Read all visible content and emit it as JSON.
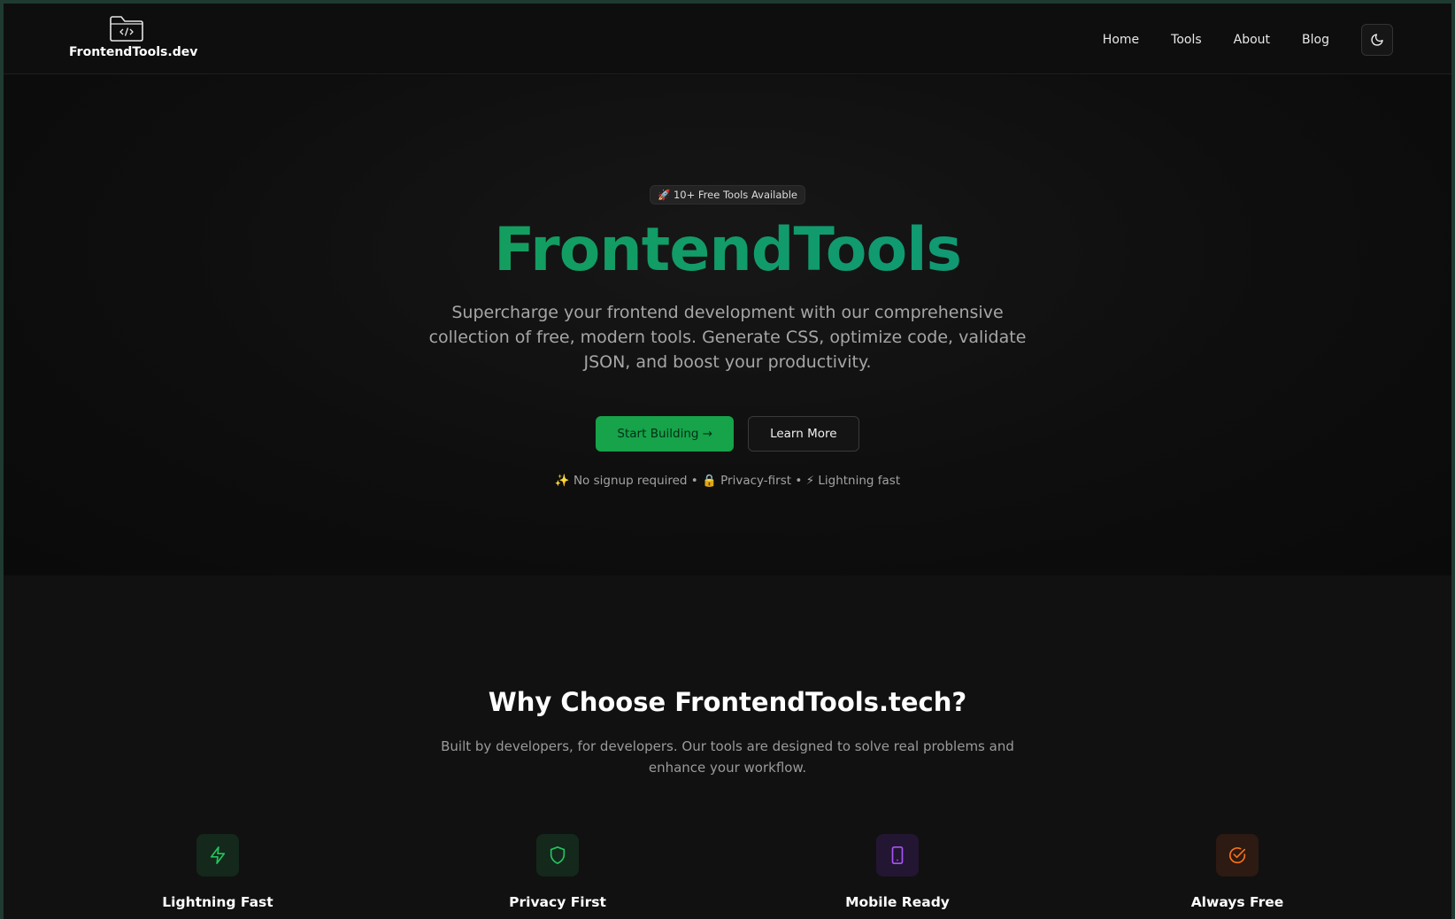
{
  "nav": {
    "logo_text": "FrontendTools.dev",
    "links": [
      "Home",
      "Tools",
      "About",
      "Blog"
    ],
    "theme_toggle_icon": "moon-icon"
  },
  "hero": {
    "badge": "🚀 10+ Free Tools Available",
    "title": "FrontendTools",
    "description": "Supercharge your frontend development with our comprehensive collection of free, modern tools. Generate CSS, optimize code, validate JSON, and boost your productivity.",
    "primary_cta": "Start Building →",
    "secondary_cta": "Learn More",
    "perks": "✨ No signup required • 🔒 Privacy-first • ⚡ Lightning fast"
  },
  "features": {
    "title": "Why Choose FrontendTools.tech?",
    "description": "Built by developers, for developers. Our tools are designed to solve real problems and enhance your workflow.",
    "items": [
      {
        "title": "Lightning Fast",
        "icon": "lightning-icon",
        "color": "#22c55e",
        "bg": "#14281c"
      },
      {
        "title": "Privacy First",
        "icon": "shield-icon",
        "color": "#22c55e",
        "bg": "#14281c"
      },
      {
        "title": "Mobile Ready",
        "icon": "mobile-icon",
        "color": "#a855f7",
        "bg": "#231632"
      },
      {
        "title": "Always Free",
        "icon": "check-circle-icon",
        "color": "#f97316",
        "bg": "#2d1a12"
      }
    ]
  },
  "colors": {
    "accent": "#16a34a",
    "accent_teal": "#0d9488",
    "background": "#0b0b0b"
  }
}
